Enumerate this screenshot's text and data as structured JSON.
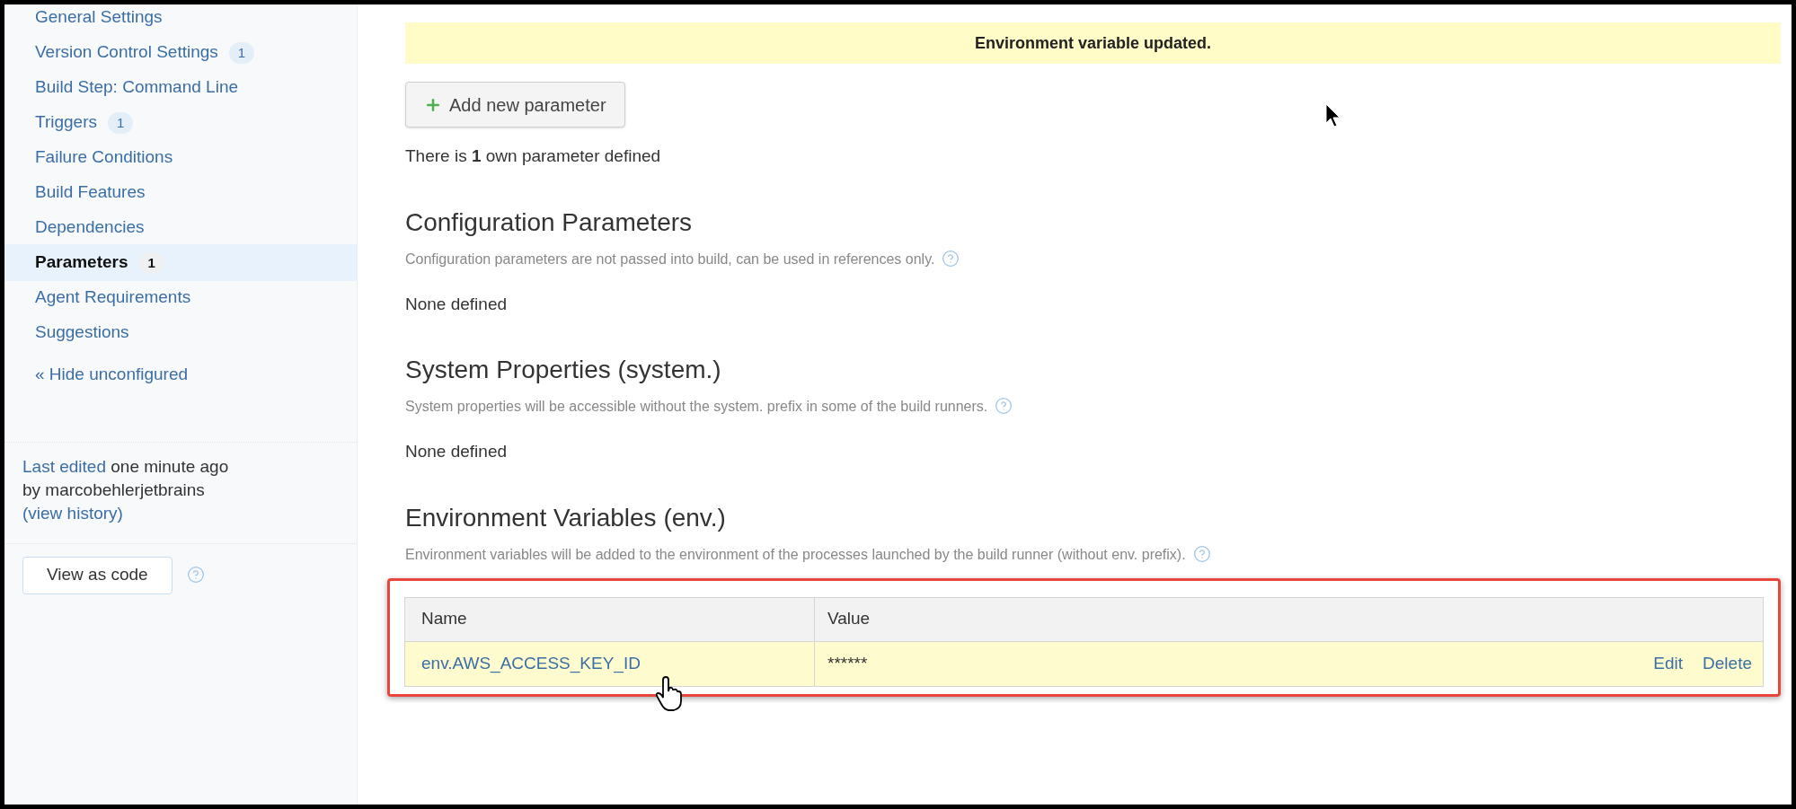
{
  "sidebar": {
    "items": [
      {
        "label": "General Settings",
        "selected": false
      },
      {
        "label": "Version Control Settings",
        "badge": "1",
        "selected": false
      },
      {
        "label": "Build Step: Command Line",
        "selected": false
      },
      {
        "label": "Triggers",
        "badge": "1",
        "selected": false
      },
      {
        "label": "Failure Conditions",
        "selected": false
      },
      {
        "label": "Build Features",
        "selected": false
      },
      {
        "label": "Dependencies",
        "selected": false
      },
      {
        "label": "Parameters",
        "badge": "1",
        "selected": true
      },
      {
        "label": "Agent Requirements",
        "selected": false
      },
      {
        "label": "Suggestions",
        "selected": false
      }
    ],
    "hide_link": "« Hide unconfigured",
    "last_edited": {
      "link": "Last edited",
      "text": "one minute ago",
      "by": "by marcobehlerjetbrains",
      "history_open": "(",
      "history_link": "view history",
      "history_close": ")"
    },
    "view_as_code": "View as code"
  },
  "main": {
    "notice": "Environment variable updated.",
    "add_button": "Add new parameter",
    "count_text": "There is **1** own parameter defined",
    "sections": [
      {
        "title": "Configuration Parameters",
        "description": "Configuration parameters are not passed into build, can be used in references only.",
        "empty_text": "None defined"
      },
      {
        "title": "System Properties (system.)",
        "description": "System properties will be accessible without the system. prefix in some of the build runners.",
        "empty_text": "None defined"
      },
      {
        "title": "Environment Variables (env.)",
        "description": "Environment variables will be added to the environment of the processes launched by the build runner (without env. prefix).",
        "table": {
          "columns": [
            "Name",
            "Value"
          ],
          "rows": [
            {
              "name": "env.AWS_ACCESS_KEY_ID",
              "value": "******",
              "actions": [
                "Edit",
                "Delete"
              ]
            }
          ]
        }
      }
    ]
  }
}
